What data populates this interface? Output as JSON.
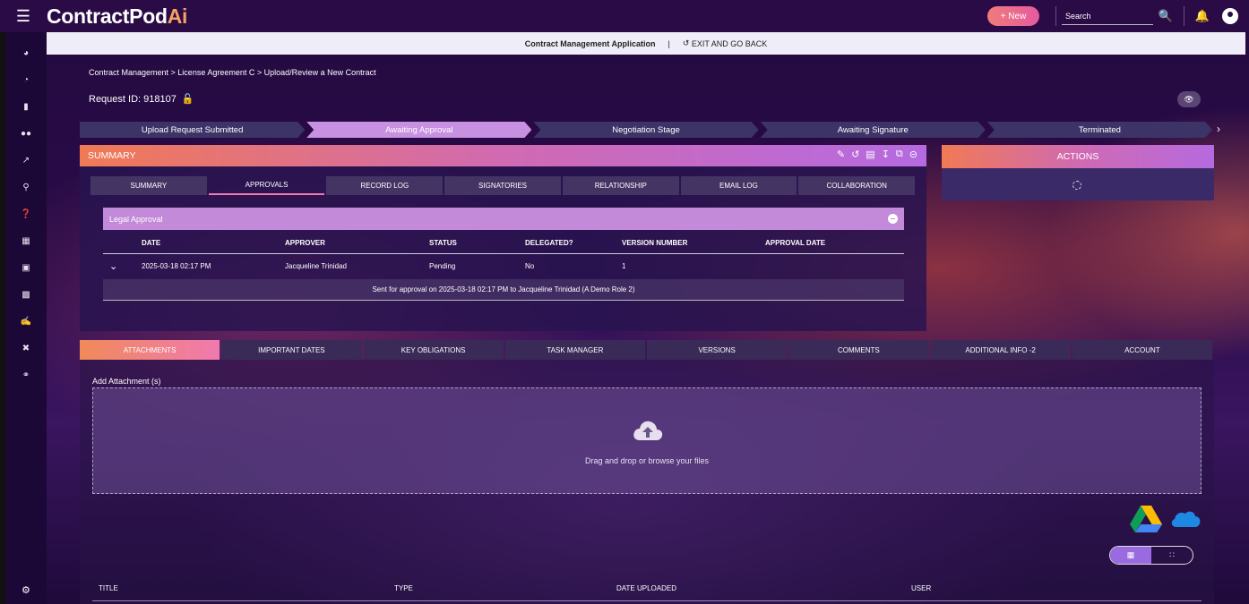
{
  "app": {
    "logo_main": "ContractPod",
    "logo_accent": "Ai",
    "new_button": "+ New",
    "search_placeholder": "Search"
  },
  "appstrip": {
    "title": "Contract Management Application",
    "separator": "|",
    "exit_label": "EXIT AND GO BACK"
  },
  "breadcrumb": "Contract Management  >  License Agreement C  >  Upload/Review a New Contract",
  "request_id": "Request ID: 918107",
  "stepper": [
    "Upload Request Submitted",
    "Awaiting Approval",
    "Negotiation Stage",
    "Awaiting Signature",
    "Terminated"
  ],
  "stepper_active_index": 1,
  "summary": {
    "title": "SUMMARY",
    "tabs": [
      "SUMMARY",
      "APPROVALS",
      "RECORD LOG",
      "SIGNATORIES",
      "RELATIONSHIP",
      "EMAIL LOG",
      "COLLABORATION"
    ],
    "active_tab": 1,
    "legal_title": "Legal Approval",
    "columns": [
      "DATE",
      "APPROVER",
      "STATUS",
      "DELEGATED?",
      "VERSION NUMBER",
      "APPROVAL DATE"
    ],
    "row": {
      "date": "2025-03-18 02:17 PM",
      "approver": "Jacqueline Trinidad",
      "status": "Pending",
      "delegated": "No",
      "version": "1",
      "approval_date": ""
    },
    "note": "Sent for approval on 2025-03-18 02:17 PM to Jacqueline Trinidad (A Demo Role 2)"
  },
  "actions": {
    "title": "ACTIONS"
  },
  "lower_tabs": [
    "ATTACHMENTS",
    "IMPORTANT DATES",
    "KEY OBLIGATIONS",
    "TASK MANAGER",
    "VERSIONS",
    "COMMENTS",
    "ADDITIONAL INFO -2",
    "ACCOUNT"
  ],
  "attachments": {
    "add_label": "Add Attachment (s)",
    "drop_text": "Drag and drop or browse your files",
    "columns": [
      "TITLE",
      "TYPE",
      "DATE UPLOADED",
      "USER"
    ]
  },
  "colors": {
    "accent_orange": "#f07a55",
    "accent_purple": "#b56ae0",
    "active_step": "#c890e0"
  }
}
